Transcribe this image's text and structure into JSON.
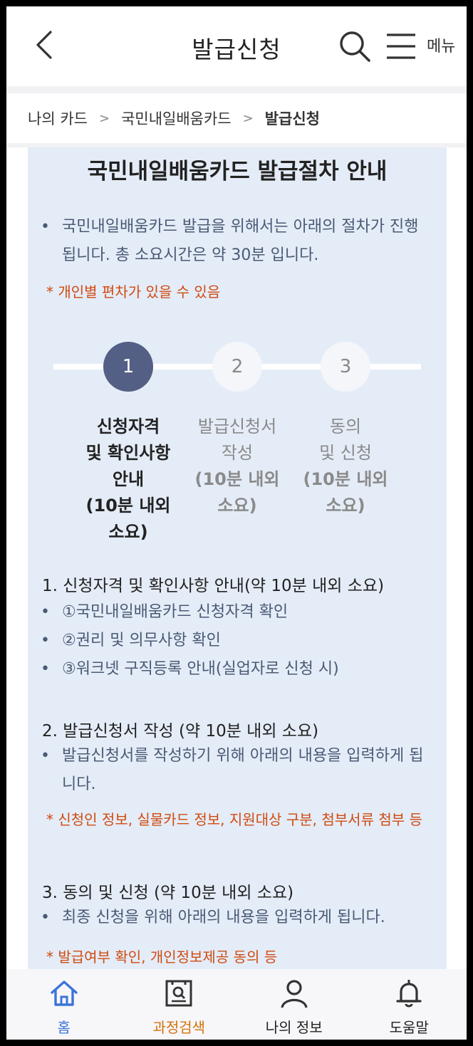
{
  "header": {
    "title": "발급신청",
    "menu_label": "메뉴"
  },
  "breadcrumb": {
    "items": [
      "나의 카드",
      "국민내일배움카드",
      "발급신청"
    ]
  },
  "content": {
    "title": "국민내일배움카드 발급절차 안내",
    "intro": {
      "bullet": "•",
      "text": "국민내일배움카드 발급을 위해서는 아래의 절차가 진행됩니다. 총 소요시간은 약 30분 입니다."
    },
    "intro_note": "* 개인별 편차가 있을 수 있음",
    "steps": [
      {
        "number": "1",
        "label": "신청자격\n및 확인사항\n안내",
        "sub": "(10분 내외\n소요)",
        "active": true
      },
      {
        "number": "2",
        "label": "발급신청서\n작성",
        "sub": "(10분 내외\n소요)",
        "active": false
      },
      {
        "number": "3",
        "label": "동의\n및 신청",
        "sub": "(10분 내외\n소요)",
        "active": false
      }
    ],
    "sections": [
      {
        "heading": "1. 신청자격 및 확인사항 안내(약 10분 내외 소요)",
        "bullets": [
          "①국민내일배움카드 신청자격 확인",
          "②권리 및 의무사항 확인",
          "③워크넷 구직등록 안내(실업자로 신청 시)"
        ],
        "note": ""
      },
      {
        "heading": "2. 발급신청서 작성 (약 10분 내외 소요)",
        "bullets": [
          "발급신청서를 작성하기 위해 아래의 내용을 입력하게 됩니다."
        ],
        "note": "* 신청인 정보, 실물카드 정보, 지원대상 구분, 첨부서류 첨부 등"
      },
      {
        "heading": "3. 동의 및 신청 (약 10분 내외 소요)",
        "bullets": [
          "최종 신청을 위해 아래의 내용을 입력하게 됩니다."
        ],
        "note": "* 발급여부 확인, 개인정보제공 동의 등"
      }
    ]
  },
  "bottom_nav": {
    "items": [
      {
        "label": "홈",
        "icon": "home-icon"
      },
      {
        "label": "과정검색",
        "icon": "course-search-icon"
      },
      {
        "label": "나의 정보",
        "icon": "person-icon"
      },
      {
        "label": "도움말",
        "icon": "bell-icon"
      }
    ]
  },
  "colors": {
    "accent_blue": "#3c74d8",
    "accent_orange": "#d4700a",
    "step_active": "#535f84",
    "note_red": "#d04a10",
    "content_bg": "#e4ecf7"
  }
}
